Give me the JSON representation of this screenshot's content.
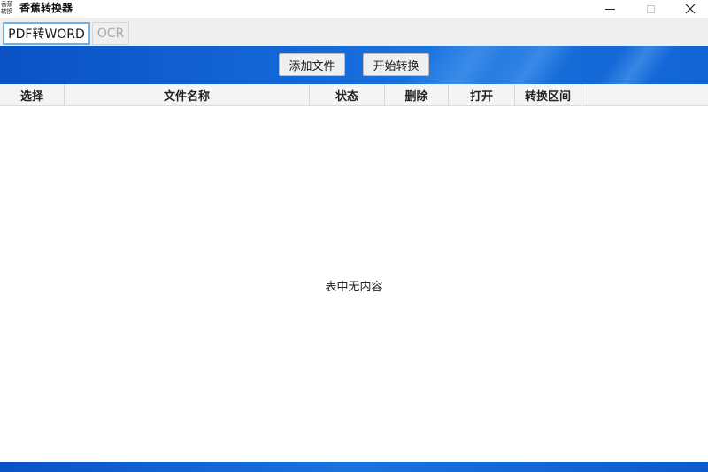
{
  "window": {
    "logo_text": "香蕉\n转换",
    "title": "香蕉转换器",
    "controls": {
      "minimize": "minimize-icon",
      "maximize": "maximize-icon",
      "close": "close-icon",
      "close_glyph": "✕"
    }
  },
  "tabs": [
    {
      "label": "PDF转WORD",
      "active": true
    },
    {
      "label": "OCR",
      "active": false
    }
  ],
  "toolbar": {
    "add_file_label": "添加文件",
    "start_convert_label": "开始转换"
  },
  "table": {
    "columns": [
      "选择",
      "文件名称",
      "状态",
      "删除",
      "打开",
      "转换区间"
    ],
    "rows": [],
    "empty_text": "表中无内容"
  },
  "colors": {
    "banner_blue": "#1466d6",
    "active_tab_border": "#6fb3e6",
    "inactive_tab_text": "#a9a9a9"
  }
}
